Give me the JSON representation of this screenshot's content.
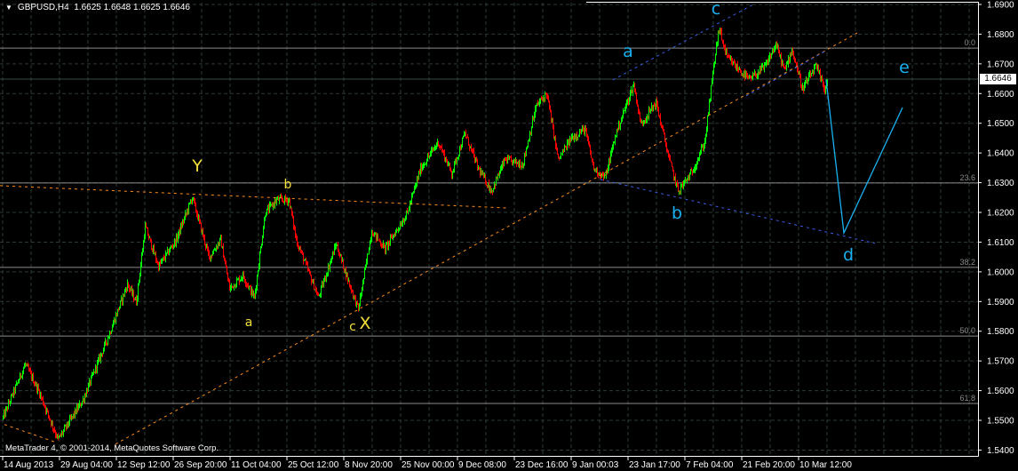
{
  "header": {
    "symbol": "GBPUSD,H4",
    "ohlc": "1.6625 1.6648 1.6625 1.6646"
  },
  "footer": {
    "copyright": "MetaTrader 4, © 2001-2014, MetaQuotes Software Corp."
  },
  "current_price": "1.6646",
  "colors": {
    "up": "#00ff00",
    "down": "#ff0000",
    "grid": "#2c3b34",
    "axis": "#ffffff",
    "fib": "#8a8a8a",
    "orange": "#ff8c1a",
    "blue": "#3a5ce6",
    "cyan": "#1ab0f0",
    "yellow": "#f2e038"
  },
  "chart_data": {
    "type": "candlestick",
    "title": "GBPUSD,H4",
    "ylim": [
      1.54,
      1.69
    ],
    "y_ticks": [
      "1.6900",
      "1.6800",
      "1.6700",
      "1.6600",
      "1.6500",
      "1.6400",
      "1.6300",
      "1.6200",
      "1.6100",
      "1.6000",
      "1.5900",
      "1.5800",
      "1.5700",
      "1.5600",
      "1.5500",
      "1.5400"
    ],
    "x_ticks": [
      "14 Aug 2013",
      "29 Aug 04:00",
      "12 Sep 12:00",
      "26 Sep 20:00",
      "11 Oct 04:00",
      "25 Oct 12:00",
      "8 Nov 20:00",
      "25 Nov 00:00",
      "9 Dec 08:00",
      "23 Dec 16:00",
      "9 Jan 00:03",
      "23 Jan 17:00",
      "7 Feb 04:00",
      "21 Feb 20:00",
      "10 Mar 12:00"
    ],
    "bars_per_x_tick": 64,
    "last_bar": {
      "open": 1.6625,
      "high": 1.6648,
      "low": 1.6625,
      "close": 1.6646
    },
    "price_path_pivots": [
      [
        0,
        1.5509
      ],
      [
        25,
        1.5689
      ],
      [
        40,
        1.56
      ],
      [
        62,
        1.5435
      ],
      [
        90,
        1.5569
      ],
      [
        120,
        1.5794
      ],
      [
        140,
        1.5958
      ],
      [
        150,
        1.5898
      ],
      [
        160,
        1.6152
      ],
      [
        175,
        1.6018
      ],
      [
        195,
        1.6108
      ],
      [
        213,
        1.6251
      ],
      [
        232,
        1.6048
      ],
      [
        245,
        1.6108
      ],
      [
        255,
        1.5943
      ],
      [
        270,
        1.5988
      ],
      [
        283,
        1.5913
      ],
      [
        295,
        1.6197
      ],
      [
        308,
        1.6242
      ],
      [
        322,
        1.6242
      ],
      [
        330,
        1.6108
      ],
      [
        355,
        1.5913
      ],
      [
        375,
        1.6093
      ],
      [
        390,
        1.5958
      ],
      [
        400,
        1.5874
      ],
      [
        415,
        1.6138
      ],
      [
        430,
        1.6078
      ],
      [
        455,
        1.6197
      ],
      [
        470,
        1.6347
      ],
      [
        490,
        1.6437
      ],
      [
        505,
        1.6332
      ],
      [
        520,
        1.6466
      ],
      [
        535,
        1.6347
      ],
      [
        550,
        1.6272
      ],
      [
        565,
        1.6377
      ],
      [
        585,
        1.6362
      ],
      [
        600,
        1.6556
      ],
      [
        612,
        1.6601
      ],
      [
        625,
        1.6377
      ],
      [
        640,
        1.6451
      ],
      [
        655,
        1.6481
      ],
      [
        665,
        1.6347
      ],
      [
        678,
        1.6317
      ],
      [
        690,
        1.6466
      ],
      [
        710,
        1.6631
      ],
      [
        718,
        1.6496
      ],
      [
        735,
        1.6571
      ],
      [
        750,
        1.6377
      ],
      [
        760,
        1.6272
      ],
      [
        775,
        1.6332
      ],
      [
        790,
        1.6437
      ],
      [
        800,
        1.6691
      ],
      [
        806,
        1.6819
      ],
      [
        815,
        1.6721
      ],
      [
        840,
        1.6646
      ],
      [
        858,
        1.6691
      ],
      [
        870,
        1.6765
      ],
      [
        880,
        1.6676
      ],
      [
        888,
        1.675
      ],
      [
        900,
        1.6616
      ],
      [
        915,
        1.6691
      ],
      [
        925,
        1.6616
      ],
      [
        928,
        1.6646
      ]
    ],
    "fibonacci": [
      {
        "label": "0.0",
        "price": 1.6753
      },
      {
        "label": "23.6",
        "price": 1.6299
      },
      {
        "label": "38.2",
        "price": 1.6015
      },
      {
        "label": "50.0",
        "price": 1.5784
      },
      {
        "label": "61.8",
        "price": 1.5557
      }
    ],
    "trendlines": [
      {
        "name": "orange-trendline-rising",
        "color": "orange",
        "points": [
          [
            127,
            1.542
          ],
          [
            962,
            1.6804
          ]
        ]
      },
      {
        "name": "orange-trendline-flat",
        "color": "orange",
        "points": [
          [
            -3,
            1.629
          ],
          [
            567,
            1.6215
          ]
        ]
      },
      {
        "name": "orange-trendline-bottom",
        "color": "orange",
        "points": [
          [
            2,
            1.5486
          ],
          [
            60,
            1.5426
          ]
        ]
      },
      {
        "name": "blue-channel-upper",
        "color": "blue",
        "points": [
          [
            687,
            1.6646
          ],
          [
            845,
            1.69
          ]
        ]
      },
      {
        "name": "blue-channel-lower",
        "color": "blue",
        "points": [
          [
            673,
            1.6311
          ],
          [
            982,
            1.6096
          ]
        ]
      },
      {
        "name": "blue-channel-mid",
        "color": "blue",
        "points": [
          [
            837,
            1.6592
          ],
          [
            927,
            1.6745
          ]
        ]
      }
    ],
    "projection": {
      "color": "cyan",
      "points": [
        [
          927,
          1.6646
        ],
        [
          947,
          1.6131
        ],
        [
          1013,
          1.6553
        ]
      ]
    },
    "wave_labels": [
      {
        "text": "Y",
        "bar": 219,
        "price": 1.6356,
        "color": "yellow",
        "size": "big"
      },
      {
        "text": "b",
        "bar": 321,
        "price": 1.6293,
        "color": "yellow",
        "size": "small"
      },
      {
        "text": "a",
        "bar": 277,
        "price": 1.5829,
        "color": "yellow",
        "size": "small"
      },
      {
        "text": "c",
        "bar": 394,
        "price": 1.5814,
        "color": "yellow",
        "size": "small"
      },
      {
        "text": "X",
        "bar": 408,
        "price": 1.5826,
        "color": "yellow",
        "size": "big"
      },
      {
        "text": "a",
        "bar": 704,
        "price": 1.6741,
        "color": "cyan",
        "size": "big"
      },
      {
        "text": "c",
        "bar": 803,
        "price": 1.6885,
        "color": "cyan",
        "size": "big"
      },
      {
        "text": "b",
        "bar": 759,
        "price": 1.6197,
        "color": "cyan",
        "size": "big"
      },
      {
        "text": "d",
        "bar": 952,
        "price": 1.6057,
        "color": "cyan",
        "size": "big"
      },
      {
        "text": "e",
        "bar": 1015,
        "price": 1.6688,
        "color": "cyan",
        "size": "big"
      }
    ]
  }
}
